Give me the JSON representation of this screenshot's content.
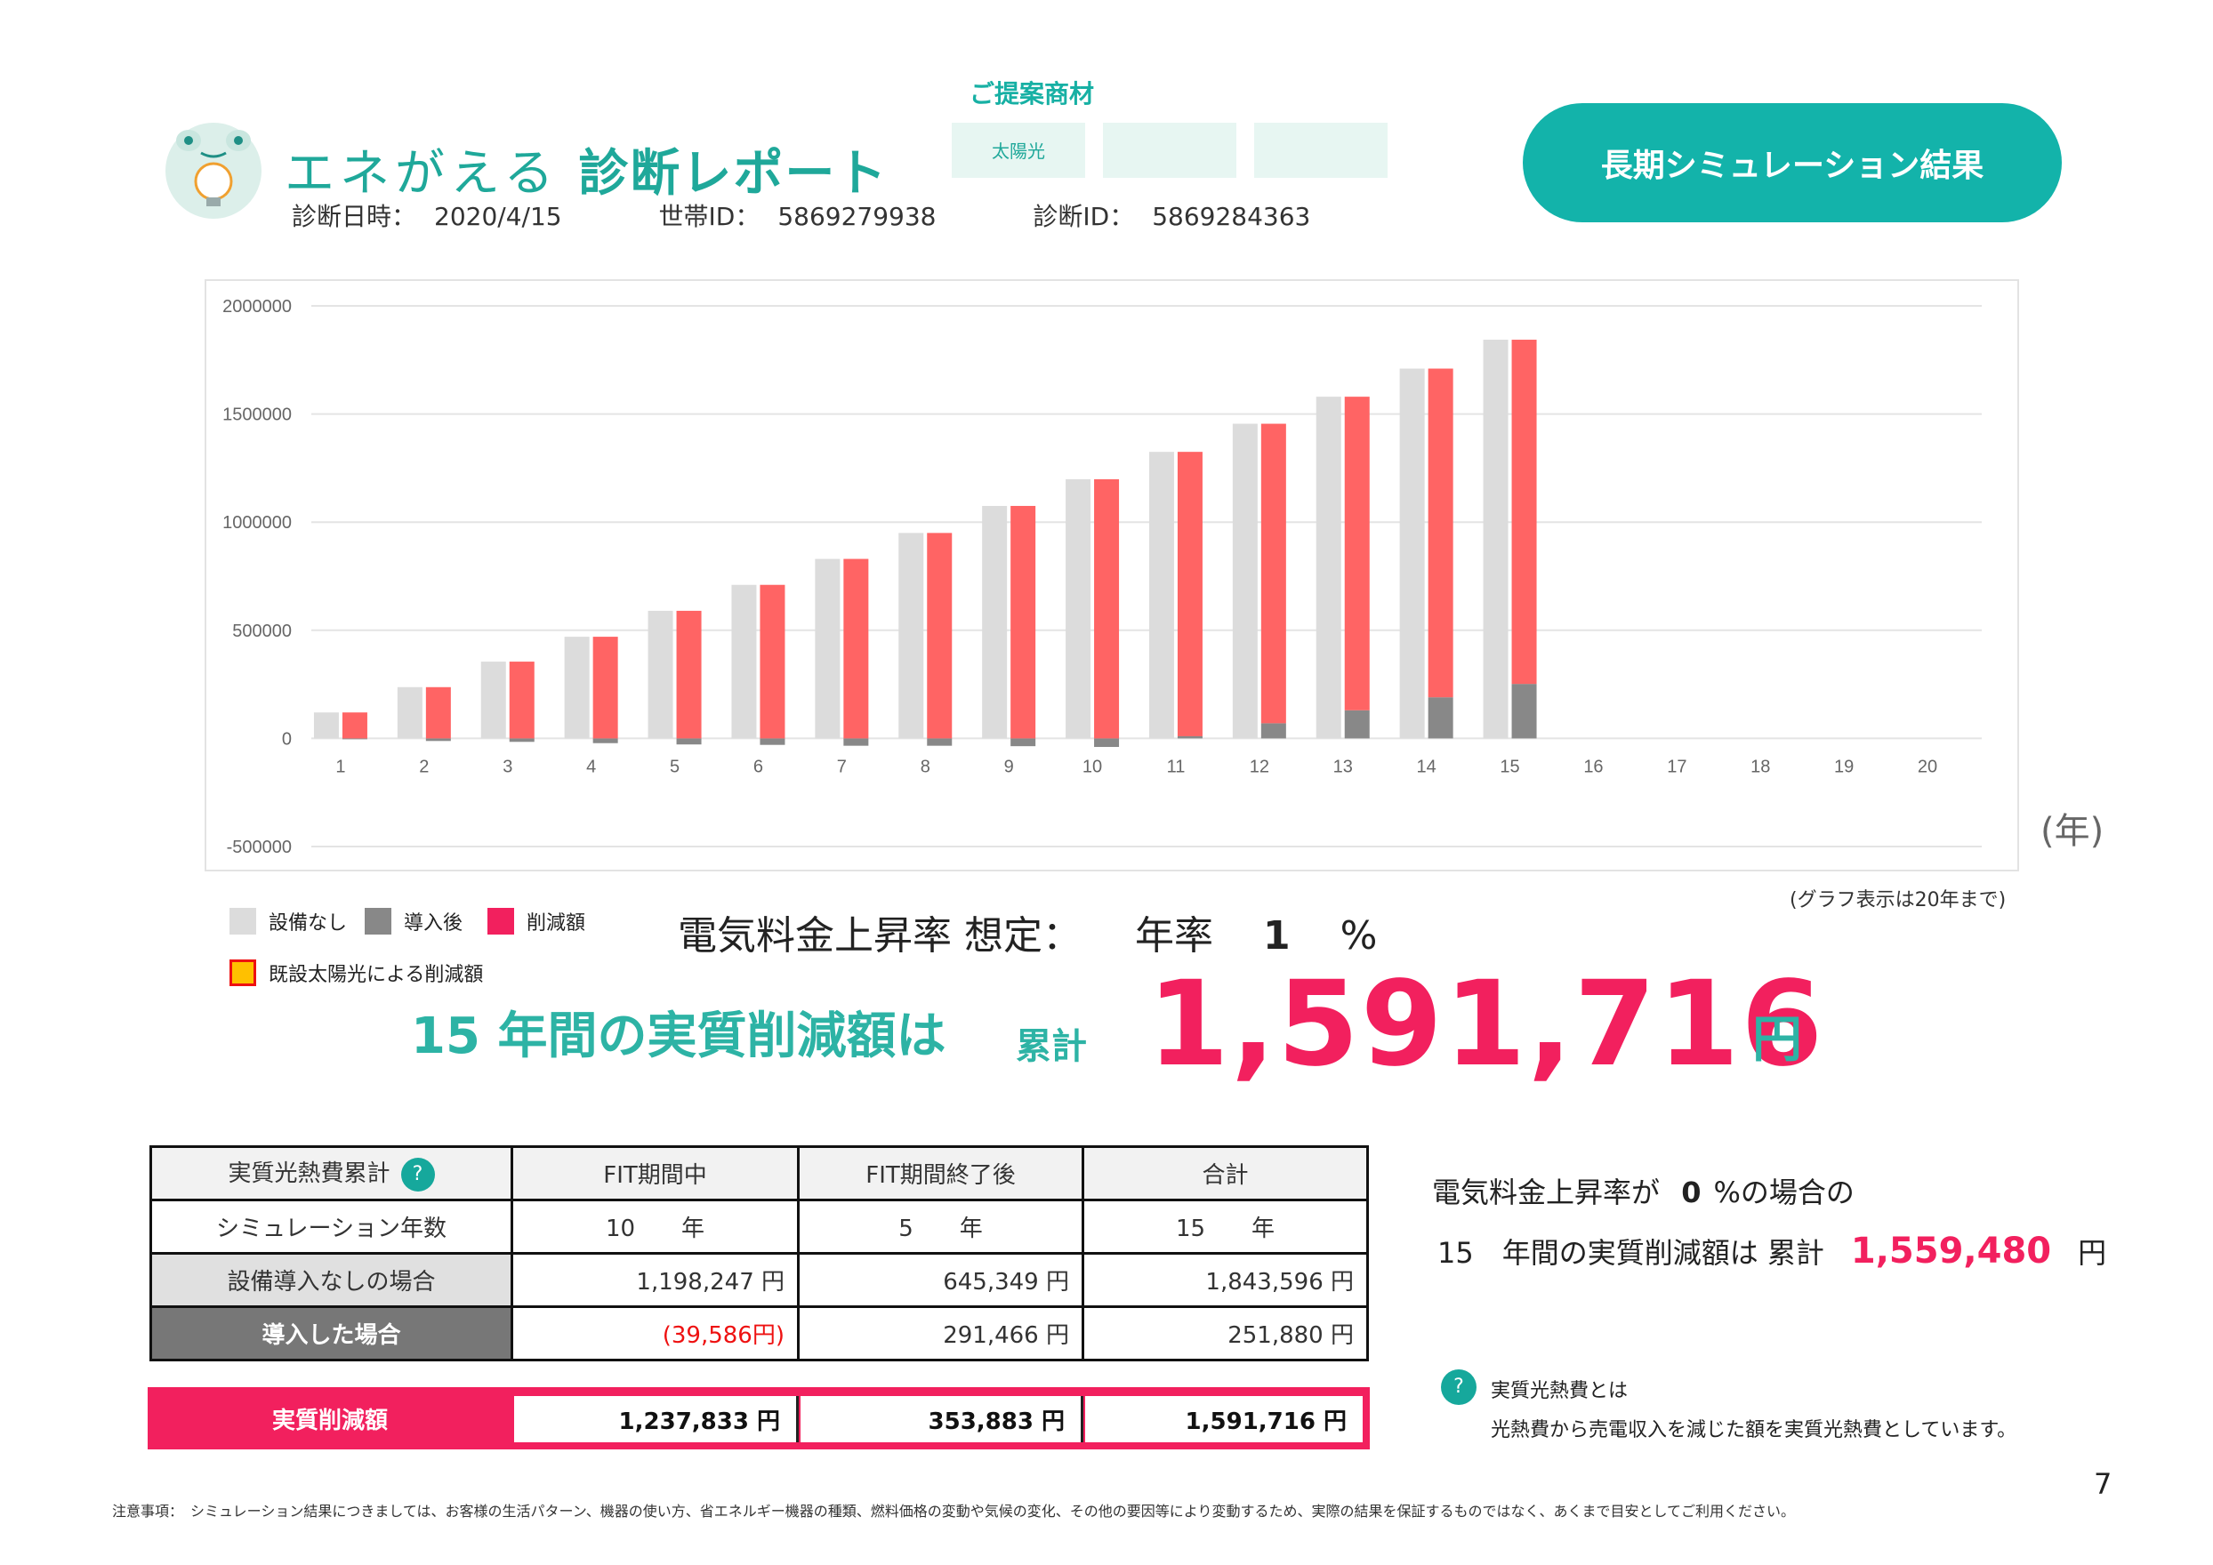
{
  "header": {
    "brand": "エネがえる",
    "report": "診断レポート",
    "date_label": "診断日時：",
    "date_value": "2020/4/15",
    "household_label": "世帯ID：",
    "household_value": "5869279938",
    "diag_label": "診断ID：",
    "diag_value": "5869284363",
    "proposal_title": "ご提案商材",
    "proposal_items": [
      "太陽光",
      "",
      ""
    ],
    "badge": "長期シミュレーション結果"
  },
  "chart_note": "(グラフ表示は20年まで)",
  "year_unit": "(年)",
  "legend": {
    "none": "設備なし",
    "after": "導入後",
    "reduction": "削減額",
    "existing": "既設太陽光による削減額"
  },
  "rate": {
    "label": "電気料金上昇率 想定：",
    "annual": "年率",
    "value": "1",
    "unit": "%"
  },
  "result": {
    "years": "15",
    "text": "年間の実質削減額は",
    "cum": "累計",
    "value": "1,591,716",
    "yen": "円"
  },
  "table": {
    "header": [
      "実質光熱費累計",
      "FIT期間中",
      "FIT期間終了後",
      "合計"
    ],
    "rows": [
      {
        "label": "シミュレーション年数",
        "v1": "10　　年",
        "v2": "5　　年",
        "v3": "15　　年"
      },
      {
        "label": "設備導入なしの場合",
        "v1": "1,198,247 円",
        "v2": "645,349 円",
        "v3": "1,843,596 円"
      },
      {
        "label": "導入した場合",
        "v1": "(39,586円)",
        "v2": "291,466 円",
        "v3": "251,880 円"
      }
    ],
    "total": {
      "label": "実質削減額",
      "v1": "1,237,833 円",
      "v2": "353,883 円",
      "v3": "1,591,716 円"
    }
  },
  "side": {
    "line1a": "電気料金上昇率が",
    "line1b": "0",
    "line1c": "%の場合の",
    "line2a": "15　年間の実質削減額は 累計",
    "line2b": "1,559,480",
    "line2c": "円",
    "q_title": "実質光熱費とは",
    "q_text": "光熱費から売電収入を減じた額を実質光熱費としています。"
  },
  "page_number": "7",
  "disclaimer": "注意事項：　シミュレーション結果につきましては、お客様の生活パターン、機器の使い方、省エネルギー機器の種類、燃料価格の変動や気候の変化、その他の要因等により変動するため、実際の結果を保証するものではなく、あくまで目安としてご利用ください。",
  "colors": {
    "teal": "#13b3aa",
    "pink": "#f2205e",
    "none_bar": "#dcdcdc",
    "after_bar": "#888888",
    "reduction_bar": "#ff6464",
    "existing_bar": "#ffc000"
  },
  "chart_data": {
    "type": "bar",
    "categories": [
      "1",
      "2",
      "3",
      "4",
      "5",
      "6",
      "7",
      "8",
      "9",
      "10",
      "11",
      "12",
      "13",
      "14",
      "15",
      "16",
      "17",
      "18",
      "19",
      "20"
    ],
    "ylim": [
      -500000,
      2000000
    ],
    "yticks": [
      2000000,
      1500000,
      1000000,
      500000,
      0,
      -500000
    ],
    "series": [
      {
        "name": "設備なし",
        "values": [
          120000,
          237000,
          355000,
          470000,
          590000,
          710000,
          830000,
          950000,
          1075000,
          1198247,
          1325000,
          1455000,
          1580000,
          1710000,
          1843596,
          null,
          null,
          null,
          null,
          null
        ]
      },
      {
        "name": "導入後",
        "values": [
          -4000,
          -12000,
          -16000,
          -22000,
          -28000,
          -30000,
          -34000,
          -34000,
          -36000,
          -39586,
          10000,
          70000,
          130000,
          190000,
          251880,
          null,
          null,
          null,
          null,
          null
        ]
      },
      {
        "name": "削減額",
        "values": [
          124000,
          249000,
          371000,
          492000,
          618000,
          740000,
          864000,
          984000,
          1111000,
          1237833,
          1315000,
          1385000,
          1450000,
          1520000,
          1591716,
          null,
          null,
          null,
          null,
          null
        ]
      }
    ]
  }
}
